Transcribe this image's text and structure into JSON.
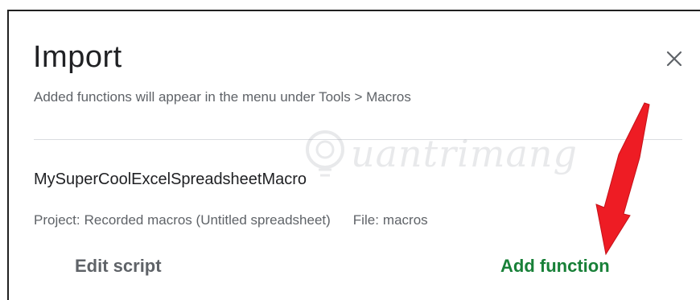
{
  "dialog": {
    "title": "Import",
    "subtitle": "Added functions will appear in the menu under Tools > Macros",
    "close_icon": "close-icon"
  },
  "function_item": {
    "name": "MySuperCoolExcelSpreadsheetMacro",
    "project_label": "Project:",
    "project_value": "Recorded macros (Untitled spreadsheet)",
    "file_label": "File:",
    "file_value": "macros"
  },
  "actions": {
    "edit_label": "Edit script",
    "add_label": "Add function"
  },
  "watermark": {
    "text": "uantrimang",
    "icon": "lightbulb-icon"
  },
  "annotation": {
    "arrow_color": "#ee1c24"
  },
  "colors": {
    "accent_green": "#188038",
    "text_secondary": "#5f6368",
    "text_primary": "#202124"
  }
}
